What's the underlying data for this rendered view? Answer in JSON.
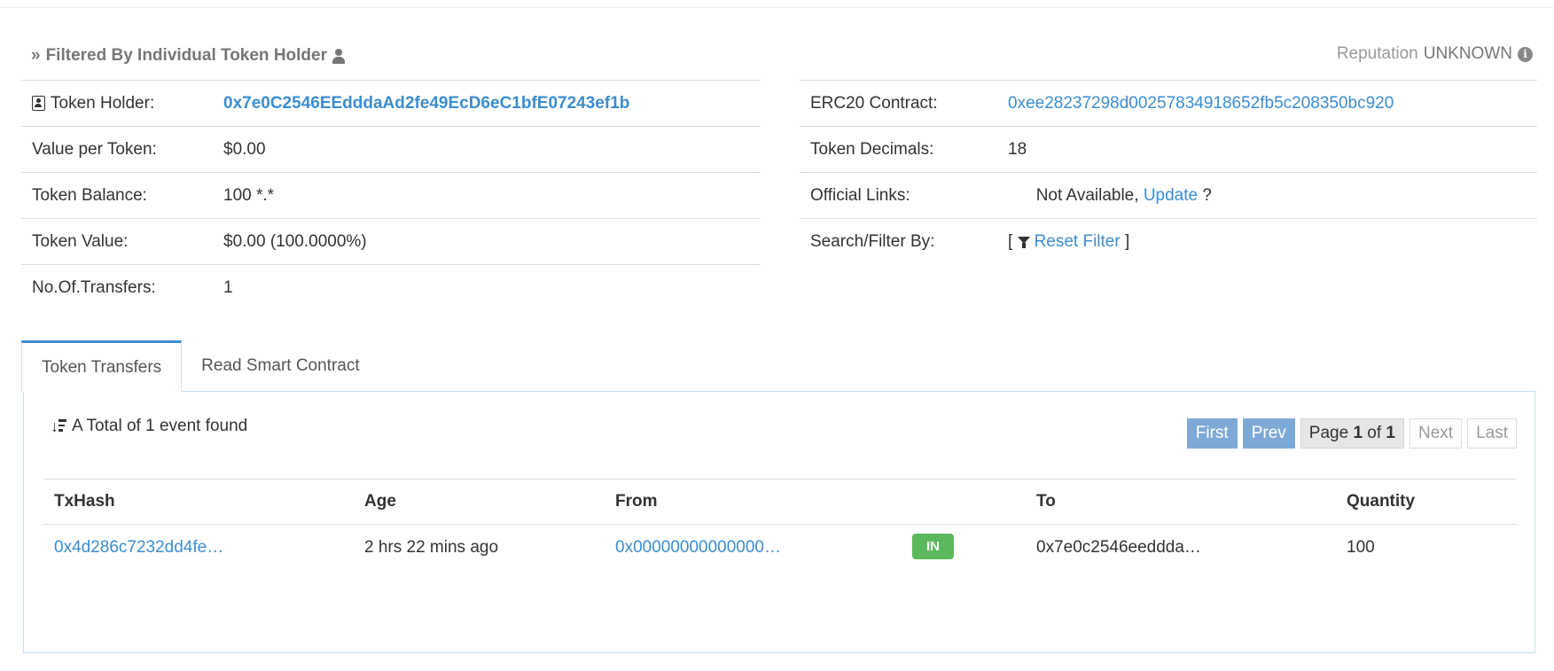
{
  "heading": {
    "prefix": "»",
    "text": "Filtered By Individual Token Holder"
  },
  "reputation": {
    "label": "Reputation",
    "value": "UNKNOWN"
  },
  "left_rows": [
    {
      "label": "Token Holder:",
      "value": "0x7e0C2546EEdddaAd2fe49EcD6eC1bfE07243ef1b"
    },
    {
      "label": "Value per Token:",
      "value": "$0.00"
    },
    {
      "label": "Token Balance:",
      "value": "100 *.*"
    },
    {
      "label": "Token Value:",
      "value": "$0.00 (100.0000%)"
    },
    {
      "label": "No.Of.Transfers:",
      "value": "1"
    }
  ],
  "right_rows": [
    {
      "label": "ERC20 Contract:",
      "value": "0xee28237298d00257834918652fb5c208350bc920"
    },
    {
      "label": "Token Decimals:",
      "value": "18"
    },
    {
      "label": "Official Links:",
      "value_prefix": "Not Available, ",
      "link": "Update",
      "suffix": " ?"
    },
    {
      "label": "Search/Filter By:",
      "open": "[ ",
      "link": "Reset Filter",
      "close": " ]"
    }
  ],
  "tabs": [
    "Token Transfers",
    "Read Smart Contract"
  ],
  "total_text": "A Total of 1 event found",
  "pager": {
    "first": "First",
    "prev": "Prev",
    "page_prefix": "Page ",
    "page_current": "1",
    "page_of": " of ",
    "page_total": "1",
    "next": "Next",
    "last": "Last"
  },
  "table": {
    "headers": [
      "TxHash",
      "Age",
      "From",
      "To",
      "Quantity"
    ],
    "rows": [
      {
        "txhash": "0x4d286c7232dd4fe…",
        "age": "2 hrs 22 mins ago",
        "from": "0x00000000000000…",
        "direction": "IN",
        "to": "0x7e0c2546eeddda…",
        "quantity": "100"
      }
    ]
  }
}
